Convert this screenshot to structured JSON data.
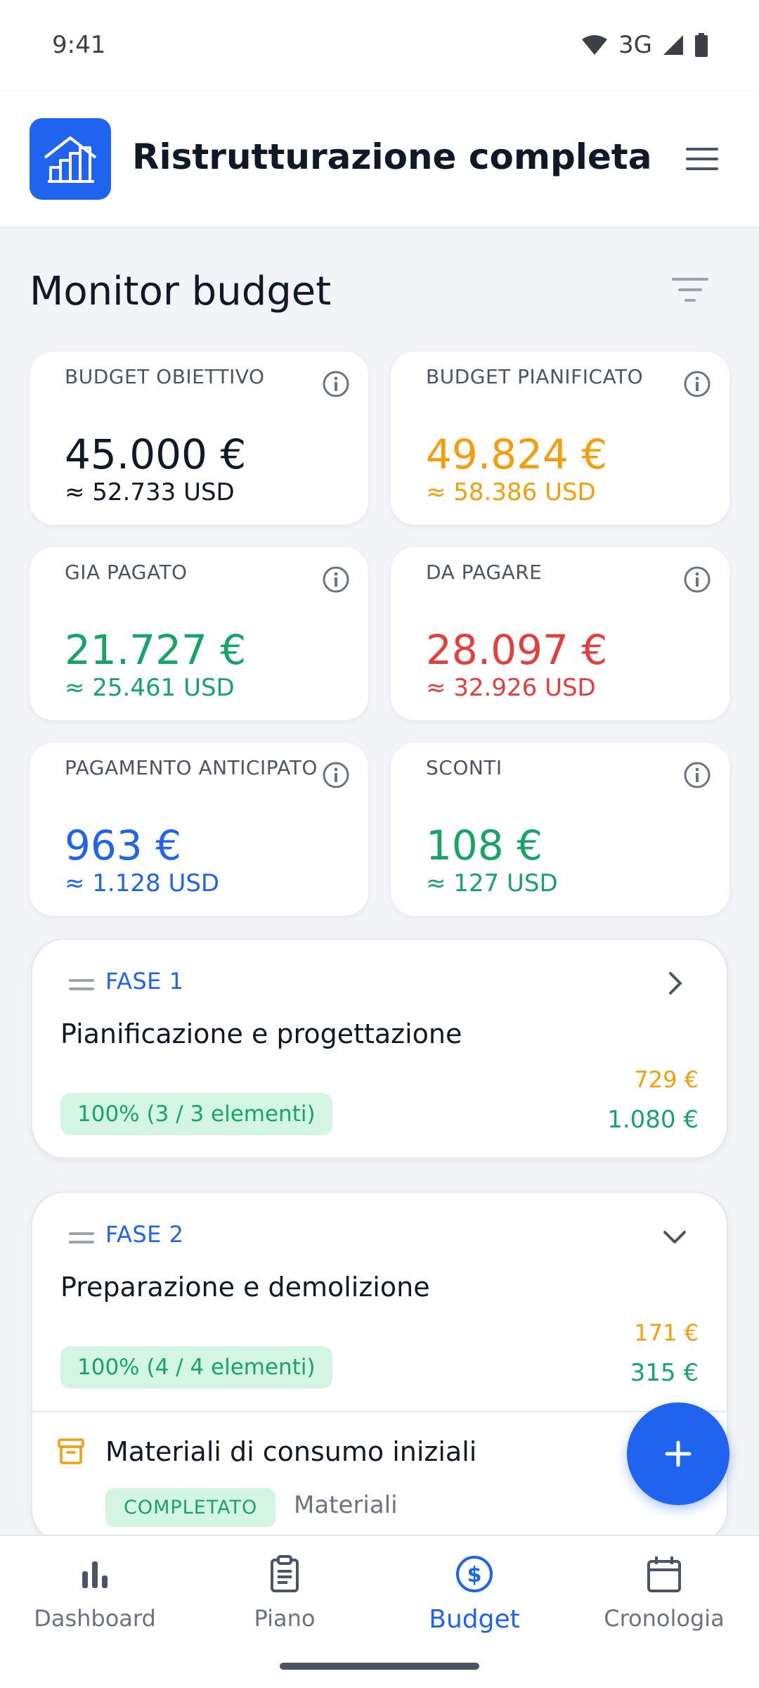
{
  "status": {
    "time": "9:41",
    "network": "3G"
  },
  "app": {
    "title": "Ristrutturazione completa"
  },
  "section": {
    "title": "Monitor budget"
  },
  "cards": [
    {
      "label": "BUDGET OBIETTIVO",
      "value": "45.000 €",
      "sub": "≈ 52.733 USD",
      "color": "#111827",
      "sub_color": "#111827"
    },
    {
      "label": "BUDGET PIANIFICATO",
      "value": "49.824 €",
      "sub": "≈ 58.386 USD",
      "color": "#f59e0b",
      "sub_color": "#f59e0b"
    },
    {
      "label": "GIA PAGATO",
      "value": "21.727 €",
      "sub": "≈ 25.461 USD",
      "color": "#16a567",
      "sub_color": "#16a567"
    },
    {
      "label": "DA PAGARE",
      "value": "28.097 €",
      "sub": "≈ 32.926 USD",
      "color": "#e53e3e",
      "sub_color": "#e53e3e"
    },
    {
      "label": "PAGAMENTO ANTICIPATO",
      "value": "963 €",
      "sub": "≈ 1.128 USD",
      "color": "#1f63ee",
      "sub_color": "#1f63ee"
    },
    {
      "label": "SCONTI",
      "value": "108 €",
      "sub": "≈ 127 USD",
      "color": "#16a567",
      "sub_color": "#16a567"
    }
  ],
  "phases": [
    {
      "label": "FASE 1",
      "title": "Pianificazione e progettazione",
      "progress": "100% (3 / 3 elementi)",
      "amount_planned": "729 €",
      "amount_paid": "1.080 €",
      "expanded": false
    },
    {
      "label": "FASE 2",
      "title": "Preparazione e demolizione",
      "progress": "100% (4 / 4 elementi)",
      "amount_planned": "171 €",
      "amount_paid": "315 €",
      "expanded": true,
      "items": [
        {
          "title": "Materiali di consumo iniziali",
          "status": "COMPLETATO",
          "category": "Materiali"
        }
      ]
    }
  ],
  "nav": {
    "items": [
      {
        "label": "Dashboard",
        "icon": "bar-chart-icon"
      },
      {
        "label": "Piano",
        "icon": "clipboard-icon"
      },
      {
        "label": "Budget",
        "icon": "dollar-circle-icon"
      },
      {
        "label": "Cronologia",
        "icon": "calendar-icon"
      }
    ],
    "active": "Budget"
  },
  "colors": {
    "accent": "#1f63ee",
    "success": "#16a567",
    "warning": "#f59e0b",
    "danger": "#e53e3e"
  }
}
